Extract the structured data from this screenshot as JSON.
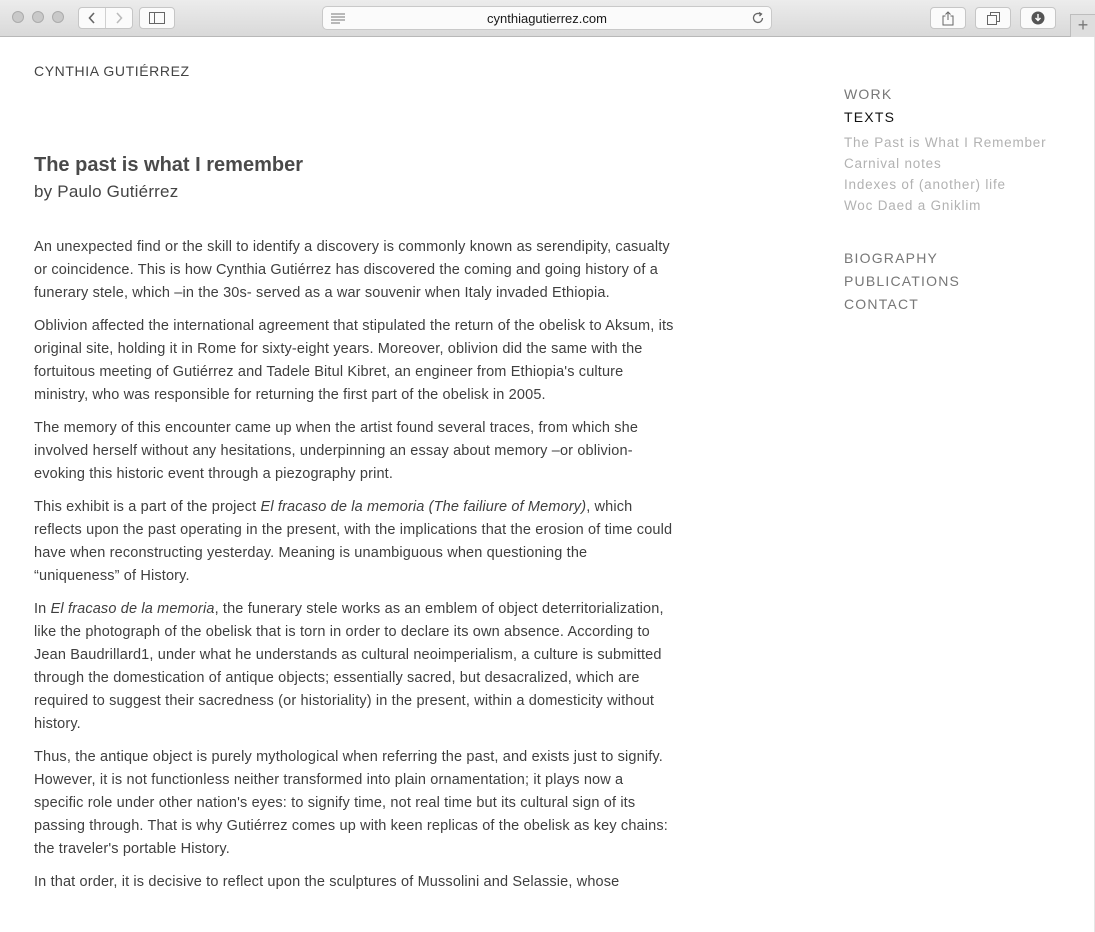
{
  "browser": {
    "url": "cynthiagutierrez.com",
    "new_tab_label": "+"
  },
  "site": {
    "title": "CYNTHIA GUTIÉRREZ"
  },
  "article": {
    "title": "The past is what I remember",
    "byline": "by Paulo Gutiérrez",
    "p1": "An unexpected find or the skill to identify a discovery is commonly known as serendipity, casualty or coincidence. This is how Cynthia Gutiérrez has discovered the coming and going history of a funerary stele, which –in the 30s- served as a war souvenir when Italy invaded Ethiopia.",
    "p2": "Oblivion affected the international agreement that stipulated the return of the obelisk to Aksum, its original site, holding it in Rome for sixty-eight years. Moreover, oblivion did the same with the fortuitous meeting of Gutiérrez and Tadele Bitul Kibret, an engineer from Ethiopia's culture ministry, who was responsible for returning the first part of the obelisk in 2005.",
    "p3": "The memory of this encounter came up when the artist found several traces, from which she involved herself without any hesitations, underpinning an essay about memory –or oblivion- evoking this historic event through a piezography print.",
    "p4_a": "This exhibit is a part of the project ",
    "p4_em": "El fracaso de la memoria (The failiure of Memory)",
    "p4_b": ", which reflects upon the past operating in the present, with the implications that the erosion of time could have when reconstructing yesterday. Meaning is unambiguous when questioning the “uniqueness” of History.",
    "p5_a": "In ",
    "p5_em": "El fracaso de la memoria",
    "p5_b": ", the funerary stele works as an emblem of object deterritorialization, like the photograph of the obelisk that is torn in order to declare its own absence. According to Jean Baudrillard1, under what he understands as cultural neoimperialism, a culture is submitted through the domestication of antique objects; essentially sacred, but desacralized, which are required to suggest their sacredness (or historiality) in the present, within a domesticity without history.",
    "p6": "Thus, the antique object is purely mythological when referring the past, and exists just to signify. However, it is not functionless neither transformed into plain ornamentation; it plays now a specific role under other nation's eyes: to signify time, not real time but its cultural sign of its passing through. That is why Gutiérrez comes up with keen replicas of the obelisk as key chains: the traveler's portable History.",
    "p7": "In that order, it is decisive to reflect upon the sculptures of Mussolini and Selassie, whose"
  },
  "nav": {
    "work": "WORK",
    "texts": "TEXTS",
    "texts_items": [
      "The Past is What I Remember",
      "Carnival notes",
      "Indexes of (another) life",
      "Woc Daed a Gniklim"
    ],
    "biography": "BIOGRAPHY",
    "publications": "PUBLICATIONS",
    "contact": "CONTACT"
  }
}
